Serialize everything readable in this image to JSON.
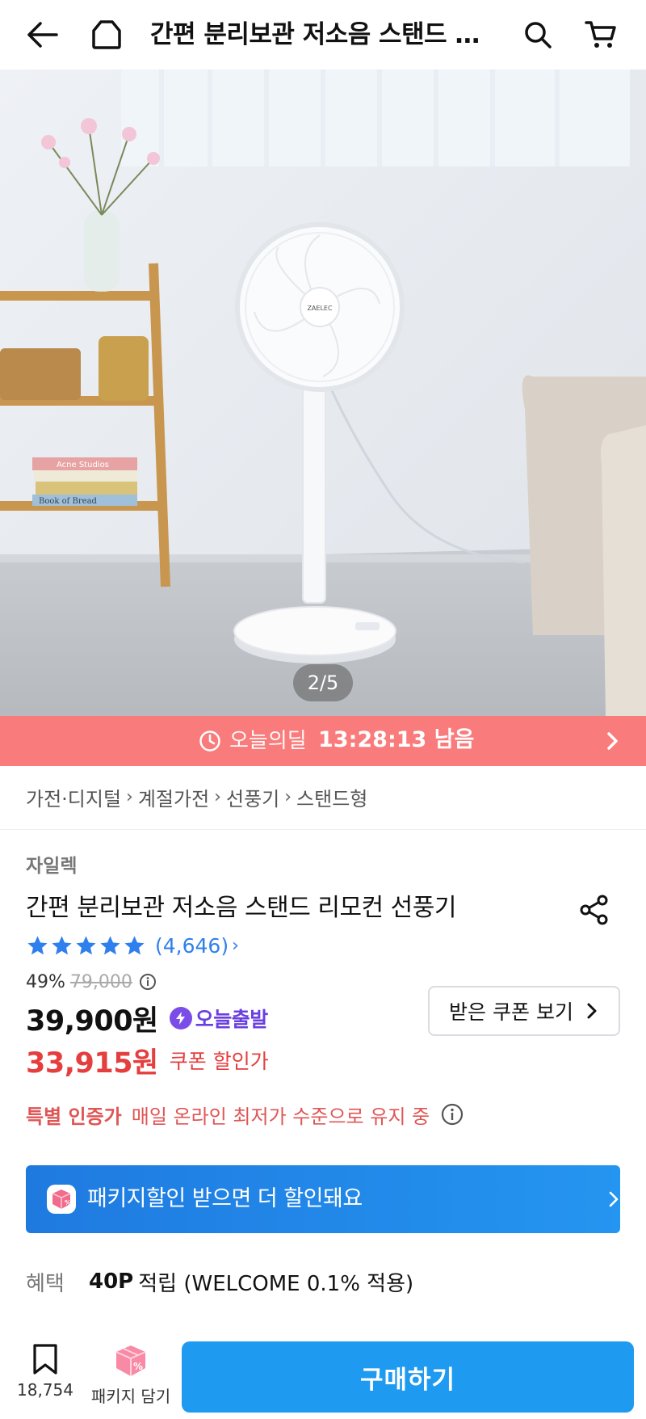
{
  "header": {
    "title": "간편 분리보관 저소음 스탠드 리모컨 선풍기",
    "back_icon": "back-arrow-icon",
    "home_icon": "home-icon",
    "search_icon": "search-icon",
    "cart_icon": "cart-icon"
  },
  "gallery": {
    "indicator": "2/5",
    "fan_brand_text": "ZAELEC",
    "book_1": "Acne Studios",
    "book_2": "Book of Bread"
  },
  "deal": {
    "label": "오늘의딜",
    "timer": "13:28:13 남음"
  },
  "breadcrumb": [
    "가전·디지털",
    "계절가전",
    "선풍기",
    "스탠드형"
  ],
  "product": {
    "brand": "자일렉",
    "title": "간편 분리보관 저소음 스탠드 리모컨 선풍기",
    "rating_stars": 5,
    "review_count": "(4,646)",
    "discount_rate": "49%",
    "original_price": "79,000",
    "sale_price": "39,900원",
    "shipping_badge": "오늘출발",
    "coupon_price": "33,915원",
    "coupon_label": "쿠폰 할인가",
    "coupon_button": "받은 쿠폰 보기",
    "special_label": "특별 인증가",
    "special_desc": "매일 온라인 최저가 수준으로 유지 중"
  },
  "package_banner": {
    "text": "패키지할인 받으면 더 할인돼요"
  },
  "benefit": {
    "label": "혜택",
    "points": "40P",
    "desc": "적립 (WELCOME 0.1% 적용)"
  },
  "bottom_bar": {
    "bookmark_count": "18,754",
    "package_add_label": "패키지 담기",
    "buy_label": "구매하기"
  },
  "colors": {
    "deal_banner": "#f97b7b",
    "accent_blue": "#1e9bf0",
    "coupon_red": "#e53e3e",
    "star_blue": "#2f80ed",
    "shipping_purple": "#6a3fe0"
  }
}
